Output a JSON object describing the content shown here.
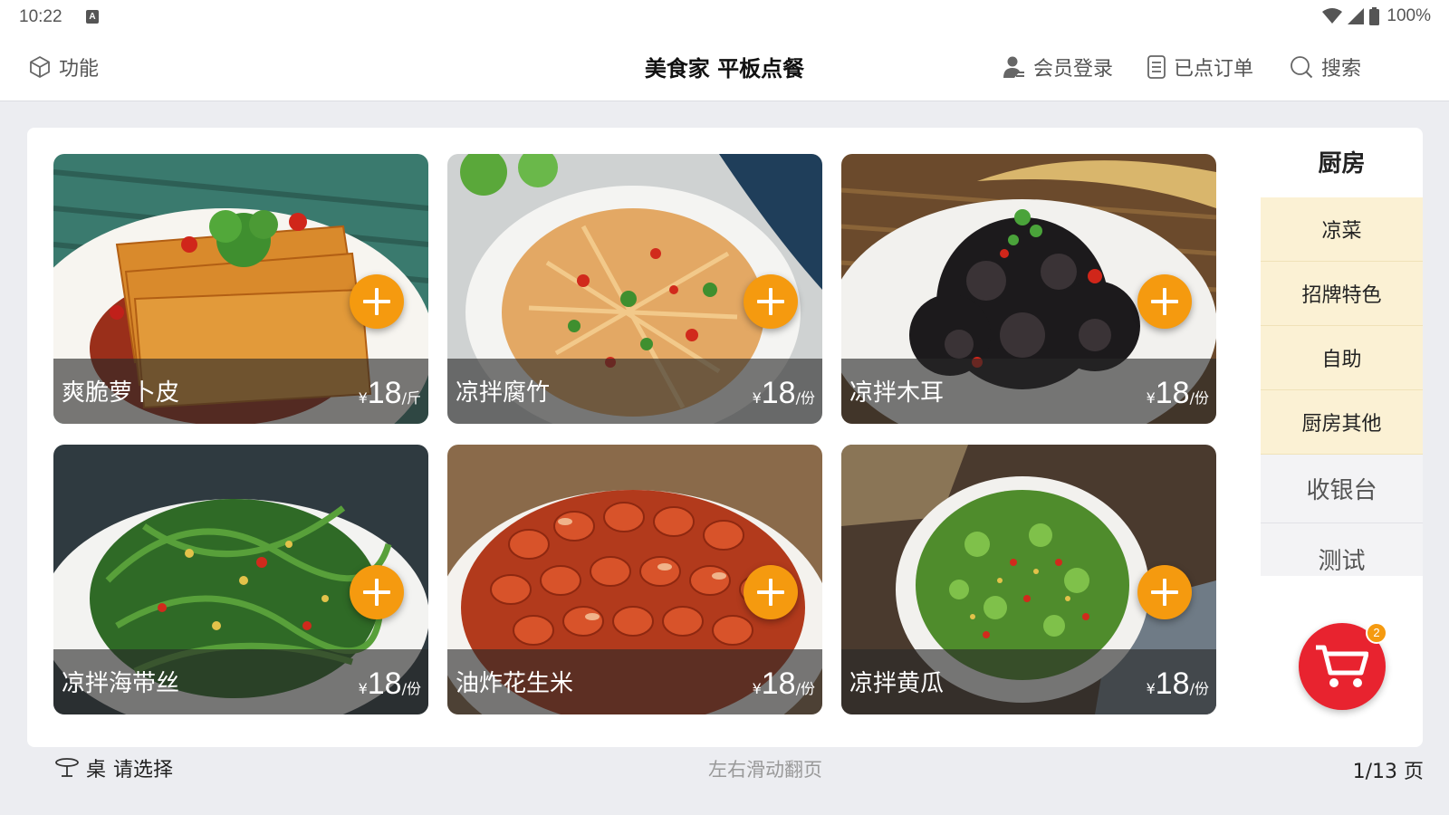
{
  "status_bar": {
    "time": "10:22",
    "notification_icon": "A",
    "battery": "100%"
  },
  "header": {
    "function_label": "功能",
    "title": "美食家 平板点餐",
    "member_login_label": "会员登录",
    "orders_label": "已点订单",
    "search_label": "搜索"
  },
  "dishes": [
    {
      "name": "爽脆萝卜皮",
      "currency": "¥",
      "price": "18",
      "unit": "/斤"
    },
    {
      "name": "凉拌腐竹",
      "currency": "¥",
      "price": "18",
      "unit": "/份"
    },
    {
      "name": "凉拌木耳",
      "currency": "¥",
      "price": "18",
      "unit": "/份"
    },
    {
      "name": "凉拌海带丝",
      "currency": "¥",
      "price": "18",
      "unit": "/份"
    },
    {
      "name": "油炸花生米",
      "currency": "¥",
      "price": "18",
      "unit": "/份"
    },
    {
      "name": "凉拌黄瓜",
      "currency": "¥",
      "price": "18",
      "unit": "/份"
    }
  ],
  "categories": {
    "title": "厨房",
    "items": [
      "凉菜",
      "招牌特色",
      "自助",
      "厨房其他",
      "收银台",
      "测试"
    ]
  },
  "cart": {
    "count": "2"
  },
  "footer": {
    "table_prefix": "桌",
    "table_value": "请选择",
    "swipe_hint": "左右滑动翻页",
    "page_info": "1/13 页"
  },
  "colors": {
    "accent_orange": "#f59a0f",
    "cart_red": "#e8232f",
    "category_bg": "#fbf1d4"
  }
}
